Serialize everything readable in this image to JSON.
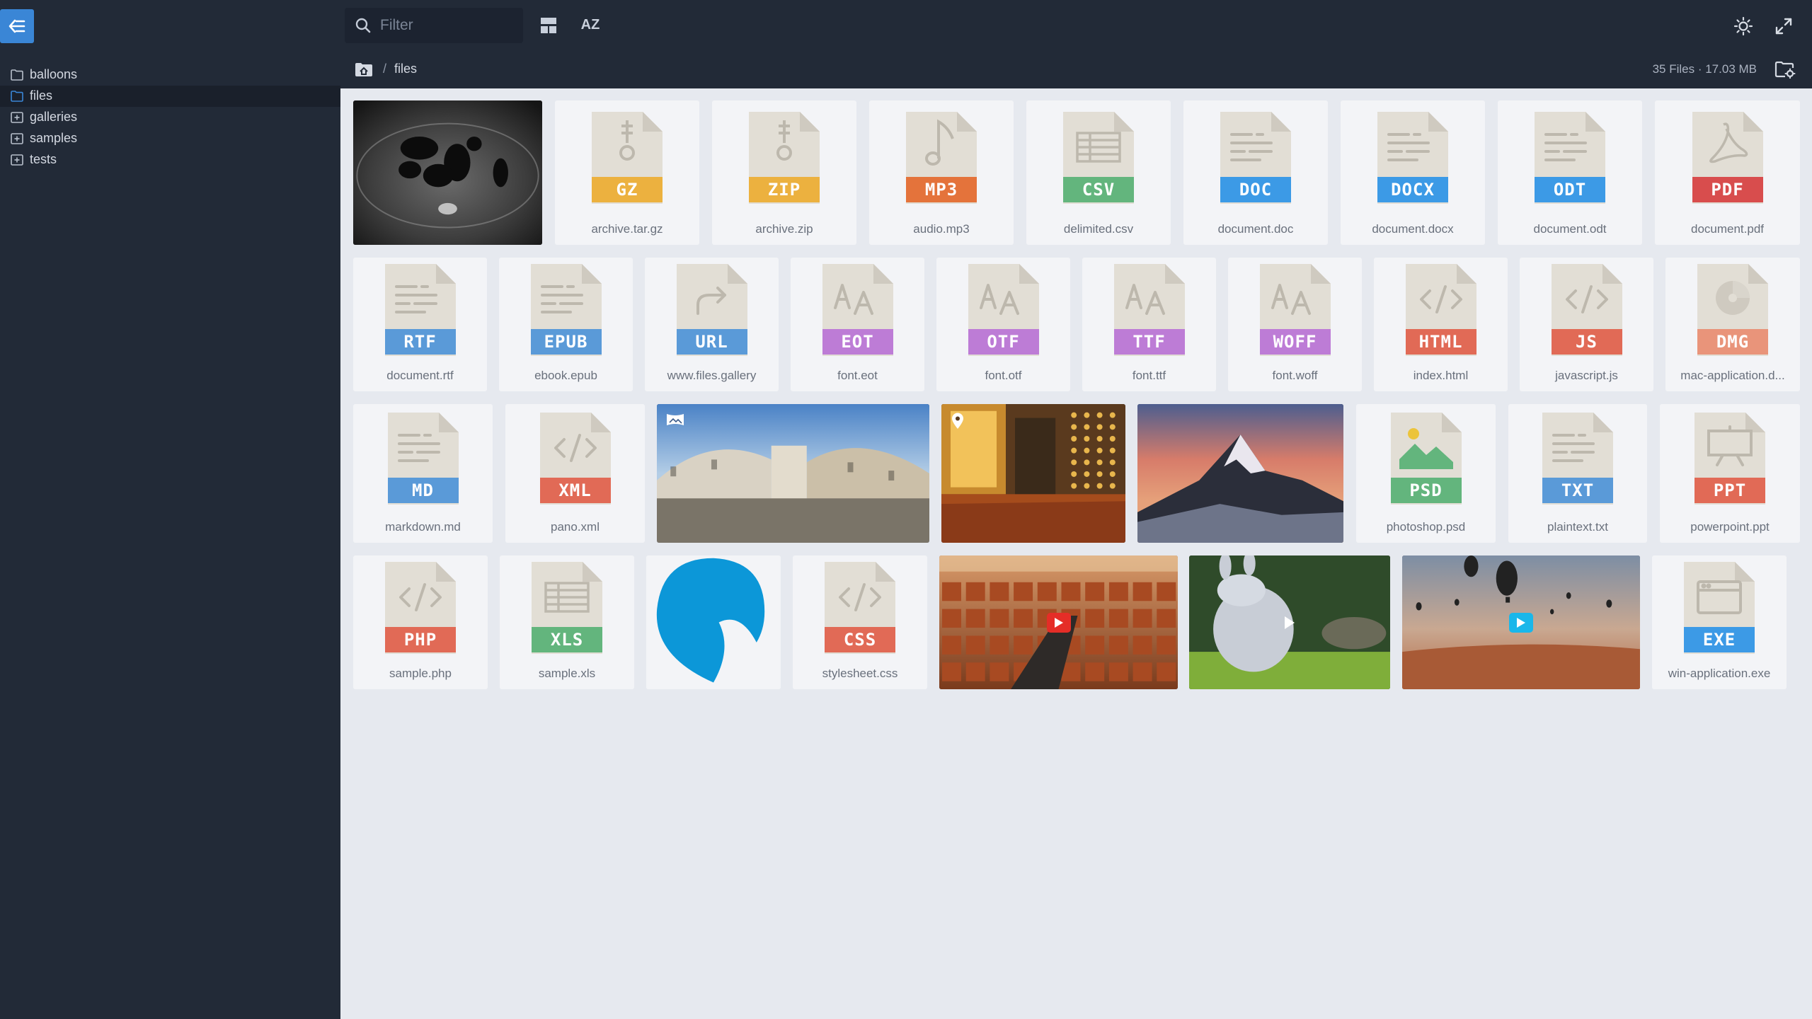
{
  "topbar": {
    "search_placeholder": "Filter",
    "sort_label": "AZ",
    "icons": [
      "sidebar-toggle-icon",
      "search-icon",
      "layout-icon",
      "sort-icon",
      "theme-icon",
      "fullscreen-icon"
    ]
  },
  "colors": {
    "dark": "#222a37",
    "accent": "#3a86d6",
    "content_bg": "#e6e9ef",
    "tile_bg": "#f3f4f7",
    "doc_paper": "#e2ded5",
    "doc_fold": "#cfcac0"
  },
  "sidebar": {
    "items": [
      {
        "label": "balloons",
        "icon": "folder-icon",
        "active": false
      },
      {
        "label": "files",
        "icon": "folder-icon",
        "active": true
      },
      {
        "label": "galleries",
        "icon": "folder-plus-icon",
        "active": false
      },
      {
        "label": "samples",
        "icon": "folder-plus-icon",
        "active": false
      },
      {
        "label": "tests",
        "icon": "folder-plus-icon",
        "active": false
      }
    ]
  },
  "breadcrumb": {
    "separator": "/",
    "current": "files",
    "file_info": "35 Files · 17.03 MB"
  },
  "files": [
    {
      "name": "",
      "kind": "image",
      "scene": "ink-dish"
    },
    {
      "name": "archive.tar.gz",
      "ext": "GZ",
      "color": "#ecb13f",
      "glyph": "zip"
    },
    {
      "name": "archive.zip",
      "ext": "ZIP",
      "color": "#ecb13f",
      "glyph": "zip"
    },
    {
      "name": "audio.mp3",
      "ext": "MP3",
      "color": "#e4733b",
      "glyph": "music"
    },
    {
      "name": "delimited.csv",
      "ext": "CSV",
      "color": "#63b57d",
      "glyph": "table"
    },
    {
      "name": "document.doc",
      "ext": "DOC",
      "color": "#3c9ae6",
      "glyph": "lines"
    },
    {
      "name": "document.docx",
      "ext": "DOCX",
      "color": "#3c9ae6",
      "glyph": "lines"
    },
    {
      "name": "document.odt",
      "ext": "ODT",
      "color": "#3c9ae6",
      "glyph": "lines"
    },
    {
      "name": "document.pdf",
      "ext": "PDF",
      "color": "#d84d4d",
      "glyph": "pdf"
    },
    {
      "name": "document.rtf",
      "ext": "RTF",
      "color": "#5a9ad8",
      "glyph": "lines"
    },
    {
      "name": "ebook.epub",
      "ext": "EPUB",
      "color": "#5a9ad8",
      "glyph": "lines"
    },
    {
      "name": "www.files.gallery",
      "ext": "URL",
      "color": "#5a9ad8",
      "glyph": "link"
    },
    {
      "name": "font.eot",
      "ext": "EOT",
      "color": "#bd7cd6",
      "glyph": "font"
    },
    {
      "name": "font.otf",
      "ext": "OTF",
      "color": "#bd7cd6",
      "glyph": "font"
    },
    {
      "name": "font.ttf",
      "ext": "TTF",
      "color": "#bd7cd6",
      "glyph": "font"
    },
    {
      "name": "font.woff",
      "ext": "WOFF",
      "color": "#bd7cd6",
      "glyph": "font"
    },
    {
      "name": "index.html",
      "ext": "HTML",
      "color": "#e16a56",
      "glyph": "code"
    },
    {
      "name": "javascript.js",
      "ext": "JS",
      "color": "#e16a56",
      "glyph": "code"
    },
    {
      "name": "mac-application.d...",
      "ext": "DMG",
      "color": "#e9947a",
      "glyph": "disc"
    },
    {
      "name": "markdown.md",
      "ext": "MD",
      "color": "#5a9ad8",
      "glyph": "lines"
    },
    {
      "name": "pano.xml",
      "ext": "XML",
      "color": "#e16a56",
      "glyph": "code"
    },
    {
      "name": "",
      "kind": "image",
      "scene": "panorama",
      "overlay": "panorama-icon"
    },
    {
      "name": "",
      "kind": "image",
      "scene": "interior",
      "overlay": "map-pin-icon"
    },
    {
      "name": "",
      "kind": "image",
      "scene": "mountain"
    },
    {
      "name": "photoshop.psd",
      "ext": "PSD",
      "color": "#63b57d",
      "glyph": "image"
    },
    {
      "name": "plaintext.txt",
      "ext": "TXT",
      "color": "#5a9ad8",
      "glyph": "lines"
    },
    {
      "name": "powerpoint.ppt",
      "ext": "PPT",
      "color": "#e16a56",
      "glyph": "presentation"
    },
    {
      "name": "sample.php",
      "ext": "PHP",
      "color": "#e16a56",
      "glyph": "code"
    },
    {
      "name": "sample.xls",
      "ext": "XLS",
      "color": "#63b57d",
      "glyph": "table"
    },
    {
      "name": "",
      "kind": "image",
      "scene": "logo"
    },
    {
      "name": "stylesheet.css",
      "ext": "CSS",
      "color": "#e16a56",
      "glyph": "code"
    },
    {
      "name": "",
      "kind": "video",
      "scene": "city",
      "overlay": "youtube-play-icon"
    },
    {
      "name": "",
      "kind": "video",
      "scene": "bunny",
      "overlay": "play-icon"
    },
    {
      "name": "",
      "kind": "video",
      "scene": "balloons",
      "overlay": "vimeo-play-icon"
    },
    {
      "name": "win-application.exe",
      "ext": "EXE",
      "color": "#3c9ae6",
      "glyph": "window"
    }
  ]
}
